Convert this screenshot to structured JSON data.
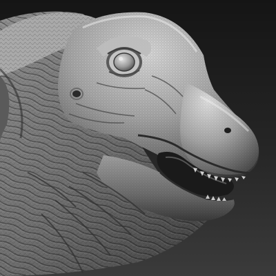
{
  "scene": {
    "subject": "sculpted-dinosaur-head",
    "material": "clay",
    "colors": {
      "background_top": "#141414",
      "background_mid": "#2a2a2a",
      "background_bottom": "#3a3a3a",
      "clay_light": "#d6d6d6",
      "clay_mid": "#9a9a9a",
      "clay_dark": "#4a4a4a",
      "clay_shadow": "#262626",
      "mouth_interior": "#1a1a1a"
    }
  }
}
